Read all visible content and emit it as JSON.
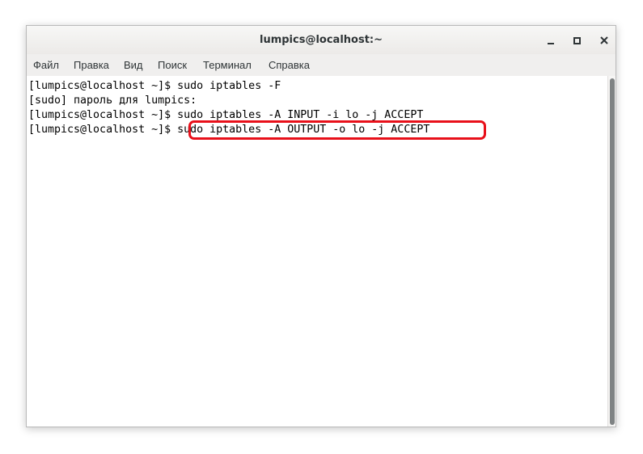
{
  "window": {
    "title": "lumpics@localhost:~"
  },
  "menu": {
    "items": [
      "Файл",
      "Правка",
      "Вид",
      "Поиск",
      "Терминал",
      "Справка"
    ]
  },
  "terminal": {
    "lines": [
      "[lumpics@localhost ~]$ sudo iptables -F",
      "[sudo] пароль для lumpics:",
      "[lumpics@localhost ~]$ sudo iptables -A INPUT -i lo -j ACCEPT",
      "[lumpics@localhost ~]$ sudo iptables -A OUTPUT -o lo -j ACCEPT"
    ],
    "highlighted_command": "sudo iptables -A OUTPUT -o lo -j ACCEPT"
  },
  "colors": {
    "highlight": "#e8101a",
    "text": "#000000",
    "titlebar": "#eceae8"
  },
  "icons": {
    "minimize": "minimize-icon",
    "maximize": "maximize-icon",
    "close": "close-icon"
  }
}
